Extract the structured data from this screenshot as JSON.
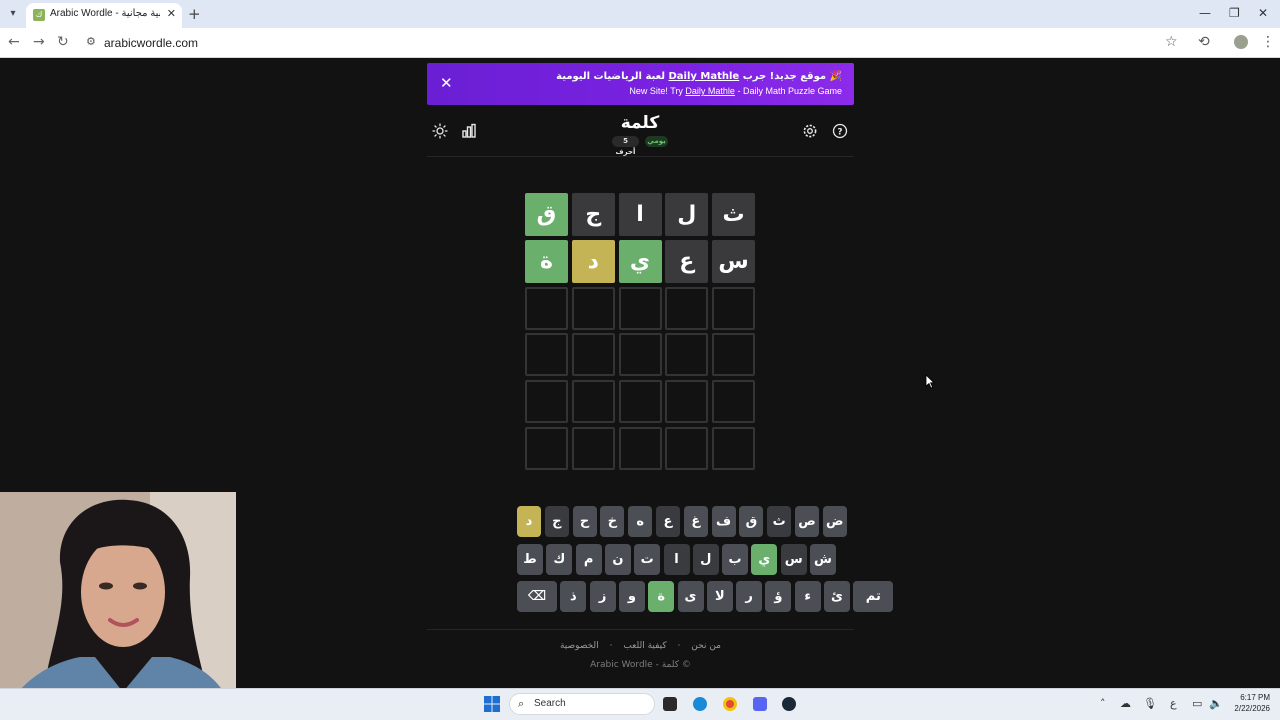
{
  "browser": {
    "tab_title": "Arabic Wordle - لعبة كلمات عربية مجانية",
    "favicon_glyph": "ك",
    "url": "arabicwordle.com"
  },
  "banner": {
    "line1_prefix": "🎉 موقع جديد! جرب ",
    "line1_link": "Daily Mathle",
    "line1_suffix": " لعبة الرياضيات اليومية",
    "line2_prefix": "New Site! Try ",
    "line2_link": "Daily Mathle",
    "line2_suffix": " - Daily Math Puzzle Game"
  },
  "header": {
    "title": "كلمة",
    "mode_badge": "يومي",
    "length_badge": "5 أحرف"
  },
  "board": [
    [
      {
        "l": "ق",
        "s": "green"
      },
      {
        "l": "ج",
        "s": "gray"
      },
      {
        "l": "ا",
        "s": "gray"
      },
      {
        "l": "ل",
        "s": "gray"
      },
      {
        "l": "ث",
        "s": "gray"
      }
    ],
    [
      {
        "l": "ة",
        "s": "green"
      },
      {
        "l": "د",
        "s": "yellow"
      },
      {
        "l": "ي",
        "s": "green"
      },
      {
        "l": "ع",
        "s": "gray"
      },
      {
        "l": "س",
        "s": "gray"
      }
    ],
    [
      {
        "l": "",
        "s": "empty"
      },
      {
        "l": "",
        "s": "empty"
      },
      {
        "l": "",
        "s": "empty"
      },
      {
        "l": "",
        "s": "empty"
      },
      {
        "l": "",
        "s": "empty"
      }
    ],
    [
      {
        "l": "",
        "s": "empty"
      },
      {
        "l": "",
        "s": "empty"
      },
      {
        "l": "",
        "s": "empty"
      },
      {
        "l": "",
        "s": "empty"
      },
      {
        "l": "",
        "s": "empty"
      }
    ],
    [
      {
        "l": "",
        "s": "empty"
      },
      {
        "l": "",
        "s": "empty"
      },
      {
        "l": "",
        "s": "empty"
      },
      {
        "l": "",
        "s": "empty"
      },
      {
        "l": "",
        "s": "empty"
      }
    ],
    [
      {
        "l": "",
        "s": "empty"
      },
      {
        "l": "",
        "s": "empty"
      },
      {
        "l": "",
        "s": "empty"
      },
      {
        "l": "",
        "s": "empty"
      },
      {
        "l": "",
        "s": "empty"
      }
    ]
  ],
  "keyboard": [
    [
      {
        "k": "د",
        "s": "yellow"
      },
      {
        "k": "ج",
        "s": "gray"
      },
      {
        "k": "ح",
        "s": "default"
      },
      {
        "k": "خ",
        "s": "default"
      },
      {
        "k": "ه",
        "s": "default"
      },
      {
        "k": "ع",
        "s": "gray"
      },
      {
        "k": "غ",
        "s": "default"
      },
      {
        "k": "ف",
        "s": "default"
      },
      {
        "k": "ق",
        "s": "default"
      },
      {
        "k": "ث",
        "s": "gray"
      },
      {
        "k": "ص",
        "s": "default"
      },
      {
        "k": "ض",
        "s": "default"
      }
    ],
    [
      {
        "k": "ط",
        "s": "default"
      },
      {
        "k": "ك",
        "s": "default"
      },
      {
        "k": "م",
        "s": "default"
      },
      {
        "k": "ن",
        "s": "default"
      },
      {
        "k": "ت",
        "s": "default"
      },
      {
        "k": "ا",
        "s": "gray"
      },
      {
        "k": "ل",
        "s": "gray"
      },
      {
        "k": "ب",
        "s": "default"
      },
      {
        "k": "ي",
        "s": "green"
      },
      {
        "k": "س",
        "s": "gray"
      },
      {
        "k": "ش",
        "s": "default"
      }
    ],
    [
      {
        "k": "⌫",
        "s": "default"
      },
      {
        "k": "ذ",
        "s": "default"
      },
      {
        "k": "ز",
        "s": "default"
      },
      {
        "k": "و",
        "s": "default"
      },
      {
        "k": "ة",
        "s": "green"
      },
      {
        "k": "ى",
        "s": "default"
      },
      {
        "k": "لا",
        "s": "default"
      },
      {
        "k": "ر",
        "s": "default"
      },
      {
        "k": "ؤ",
        "s": "default"
      },
      {
        "k": "ء",
        "s": "default"
      },
      {
        "k": "ئ",
        "s": "default"
      },
      {
        "k": "تم",
        "s": "default"
      }
    ]
  ],
  "footer": {
    "links": [
      "من نحن",
      "كيفية اللعب",
      "الخصوصية"
    ],
    "copyright": "© كلمة - Arabic Wordle"
  },
  "taskbar": {
    "search_placeholder": "Search",
    "time": "6:17 PM",
    "date": "2/22/2026",
    "input_indicator": "ع"
  },
  "colors": {
    "tile_green": "#6ab06c",
    "tile_yellow": "#c5b455",
    "tile_gray": "#3a3a3c",
    "banner_purple": "#7b22e2"
  }
}
